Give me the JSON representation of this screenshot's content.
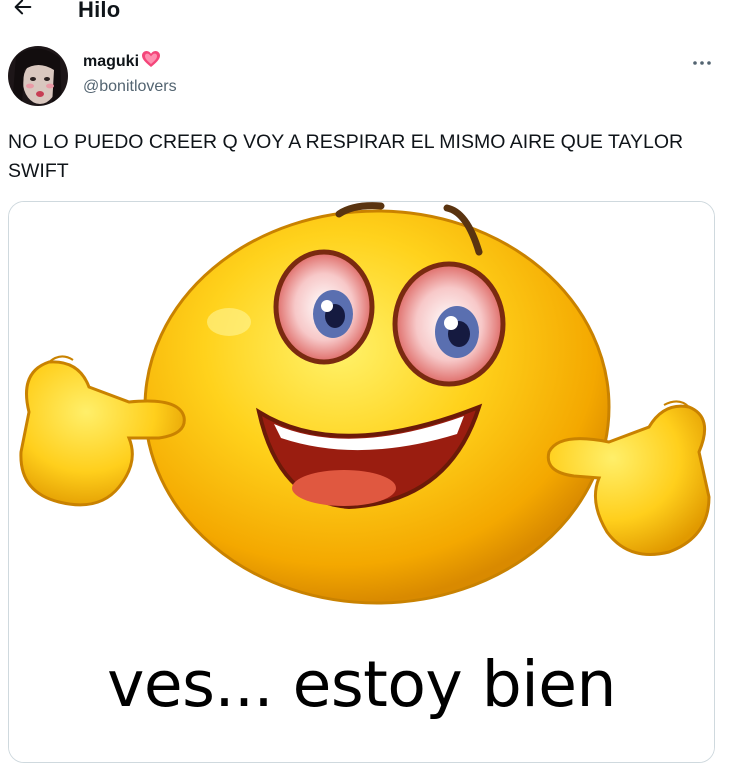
{
  "header": {
    "title": "Hilo",
    "back_icon": "arrow-left-icon"
  },
  "tweet": {
    "author": {
      "display_name": "maguki",
      "handle": "@bonitlovers",
      "name_emoji": "pink-heart-icon"
    },
    "more_icon": "more-horizontal-icon",
    "text": "NO LO PUEDO CREER Q VOY A RESPIRAR EL MISMO AIRE QUE TAYLOR SWIFT",
    "media": {
      "caption": "ves... estoy bien"
    }
  },
  "colors": {
    "text": "#0f1419",
    "secondary": "#536471",
    "border": "#cfd9de",
    "heart": "#f4467a"
  }
}
